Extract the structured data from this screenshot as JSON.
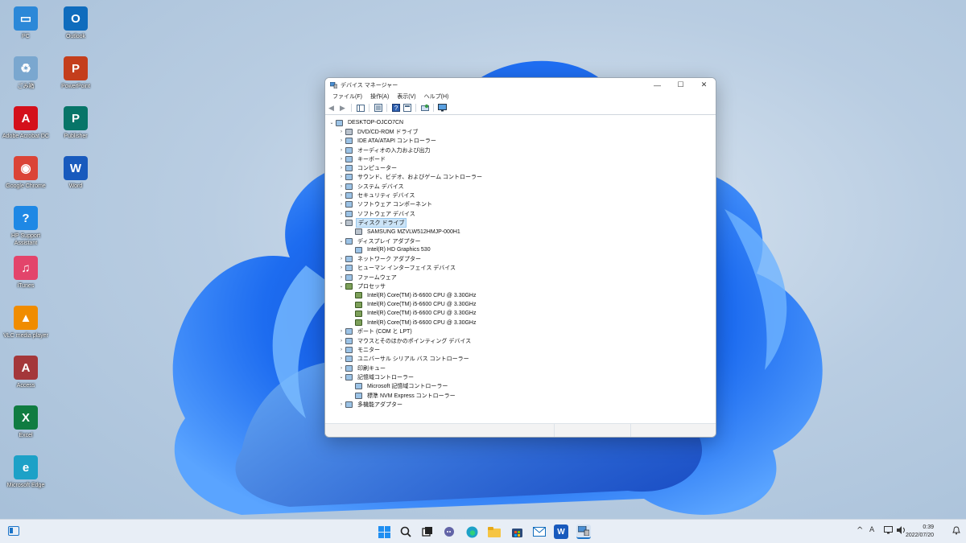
{
  "desktop": {
    "icons": [
      {
        "label": "PC",
        "glyph": "▭",
        "color": "#2b88d8"
      },
      {
        "label": "Outlook",
        "glyph": "O",
        "color": "#0f6cbd"
      },
      {
        "label": "ごみ箱",
        "glyph": "♻",
        "color": "#7aa7cf"
      },
      {
        "label": "PowerPoint",
        "glyph": "P",
        "color": "#c43e1c"
      },
      {
        "label": "Adobe Acrobat DC",
        "glyph": "A",
        "color": "#d4101b"
      },
      {
        "label": "Publisher",
        "glyph": "P",
        "color": "#077568"
      },
      {
        "label": "Google Chrome",
        "glyph": "◉",
        "color": "#db4437"
      },
      {
        "label": "Word",
        "glyph": "W",
        "color": "#185abd"
      },
      {
        "label": "HP Support Assistant",
        "glyph": "?",
        "color": "#1e88e5"
      },
      {
        "label": "iTunes",
        "glyph": "♫",
        "color": "#e3446b"
      },
      {
        "label": "VLC media player",
        "glyph": "▲",
        "color": "#f08c00"
      },
      {
        "label": "Access",
        "glyph": "A",
        "color": "#a4373a"
      },
      {
        "label": "Excel",
        "glyph": "X",
        "color": "#107c41"
      },
      {
        "label": "Microsoft Edge",
        "glyph": "e",
        "color": "#1da1c7"
      }
    ]
  },
  "window": {
    "title": "デバイス マネージャー",
    "controls": {
      "minimize": "—",
      "maximize": "☐",
      "close": "✕"
    },
    "menu": [
      "ファイル(F)",
      "操作(A)",
      "表示(V)",
      "ヘルプ(H)"
    ],
    "tree": [
      {
        "text": "DESKTOP-OJCO7CN",
        "level": 0,
        "exp": "⌄",
        "icon": "pc"
      },
      {
        "text": "DVD/CD-ROM ドライブ",
        "level": 1,
        "exp": "›",
        "icon": "disk"
      },
      {
        "text": "IDE ATA/ATAPI コントローラー",
        "level": 1,
        "exp": "›",
        "icon": "ctrl"
      },
      {
        "text": "オーディオの入力および出力",
        "level": 1,
        "exp": "›",
        "icon": "audio"
      },
      {
        "text": "キーボード",
        "level": 1,
        "exp": "›",
        "icon": "kbd"
      },
      {
        "text": "コンピューター",
        "level": 1,
        "exp": "›",
        "icon": "pc"
      },
      {
        "text": "サウンド、ビデオ、およびゲーム コントローラー",
        "level": 1,
        "exp": "›",
        "icon": "audio"
      },
      {
        "text": "システム デバイス",
        "level": 1,
        "exp": "›",
        "icon": "sys"
      },
      {
        "text": "セキュリティ デバイス",
        "level": 1,
        "exp": "›",
        "icon": "sec"
      },
      {
        "text": "ソフトウェア コンポーネント",
        "level": 1,
        "exp": "›",
        "icon": "sw"
      },
      {
        "text": "ソフトウェア デバイス",
        "level": 1,
        "exp": "›",
        "icon": "sw"
      },
      {
        "text": "ディスク ドライブ",
        "level": 1,
        "exp": "⌄",
        "icon": "disk",
        "selected": true
      },
      {
        "text": "SAMSUNG MZVLW512HMJP-000H1",
        "level": 2,
        "exp": "",
        "icon": "disk"
      },
      {
        "text": "ディスプレイ アダプター",
        "level": 1,
        "exp": "⌄",
        "icon": "disp"
      },
      {
        "text": "Intel(R) HD Graphics 530",
        "level": 2,
        "exp": "",
        "icon": "disp"
      },
      {
        "text": "ネットワーク アダプター",
        "level": 1,
        "exp": "›",
        "icon": "net"
      },
      {
        "text": "ヒューマン インターフェイス デバイス",
        "level": 1,
        "exp": "›",
        "icon": "hid"
      },
      {
        "text": "ファームウェア",
        "level": 1,
        "exp": "›",
        "icon": "fw"
      },
      {
        "text": "プロセッサ",
        "level": 1,
        "exp": "⌄",
        "icon": "cpu"
      },
      {
        "text": "Intel(R) Core(TM) i5-6600 CPU @ 3.30GHz",
        "level": 2,
        "exp": "",
        "icon": "cpu"
      },
      {
        "text": "Intel(R) Core(TM) i5-6600 CPU @ 3.30GHz",
        "level": 2,
        "exp": "",
        "icon": "cpu"
      },
      {
        "text": "Intel(R) Core(TM) i5-6600 CPU @ 3.30GHz",
        "level": 2,
        "exp": "",
        "icon": "cpu"
      },
      {
        "text": "Intel(R) Core(TM) i5-6600 CPU @ 3.30GHz",
        "level": 2,
        "exp": "",
        "icon": "cpu"
      },
      {
        "text": "ポート (COM と LPT)",
        "level": 1,
        "exp": "›",
        "icon": "port"
      },
      {
        "text": "マウスとそのほかのポインティング デバイス",
        "level": 1,
        "exp": "›",
        "icon": "mouse"
      },
      {
        "text": "モニター",
        "level": 1,
        "exp": "›",
        "icon": "disp"
      },
      {
        "text": "ユニバーサル シリアル バス コントローラー",
        "level": 1,
        "exp": "›",
        "icon": "usb"
      },
      {
        "text": "印刷キュー",
        "level": 1,
        "exp": "›",
        "icon": "print"
      },
      {
        "text": "記憶域コントローラー",
        "level": 1,
        "exp": "⌄",
        "icon": "stor"
      },
      {
        "text": "Microsoft 記憶域コントローラー",
        "level": 2,
        "exp": "",
        "icon": "stor"
      },
      {
        "text": "標準 NVM Express コントローラー",
        "level": 2,
        "exp": "",
        "icon": "stor"
      },
      {
        "text": "多機能アダプター",
        "level": 1,
        "exp": "›",
        "icon": "multi"
      }
    ]
  },
  "taskbar": {
    "apps": [
      "start-icon",
      "search-icon",
      "task-view-icon",
      "chat-icon",
      "edge-icon",
      "explorer-icon",
      "store-icon",
      "mail-icon",
      "word-icon",
      "device-manager-icon"
    ],
    "clock_time": "0:39",
    "clock_date": "2022/07/20",
    "tray_caret": "^",
    "ime": "A"
  }
}
